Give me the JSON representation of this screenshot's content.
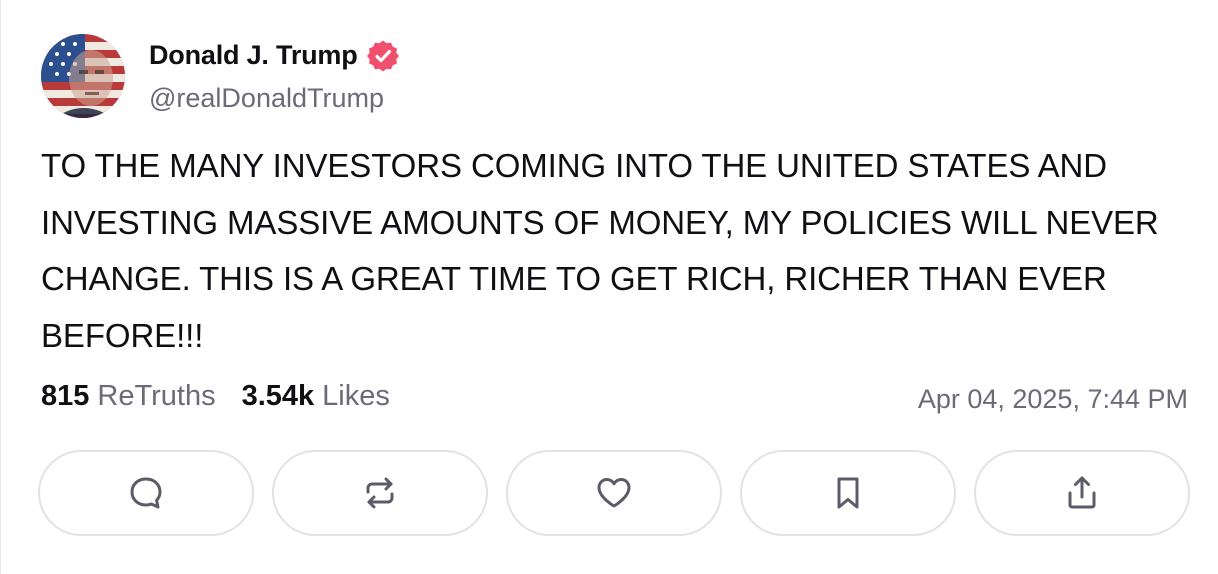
{
  "author": {
    "display_name": "Donald J. Trump",
    "handle": "@realDonaldTrump",
    "avatar_icon": "flag-portrait-avatar",
    "verified_icon": "verified-badge-icon",
    "verified_color": "#f0506e"
  },
  "post": {
    "text": "TO THE MANY INVESTORS COMING INTO THE UNITED STATES AND INVESTING MASSIVE AMOUNTS OF MONEY, MY POLICIES WILL NEVER CHANGE. THIS IS A GREAT TIME TO GET RICH, RICHER THAN EVER BEFORE!!!"
  },
  "stats": {
    "retruths_count": "815",
    "retruths_label": "ReTruths",
    "likes_count": "3.54k",
    "likes_label": "Likes",
    "timestamp": "Apr 04, 2025, 7:44 PM"
  },
  "actions": [
    {
      "icon": "reply-icon"
    },
    {
      "icon": "retruth-icon"
    },
    {
      "icon": "heart-icon"
    },
    {
      "icon": "bookmark-icon"
    },
    {
      "icon": "share-icon"
    }
  ],
  "colors": {
    "text": "#0f0f14",
    "muted": "#6b6b78",
    "border": "#e2e2e8",
    "icon": "#5c5c68"
  }
}
